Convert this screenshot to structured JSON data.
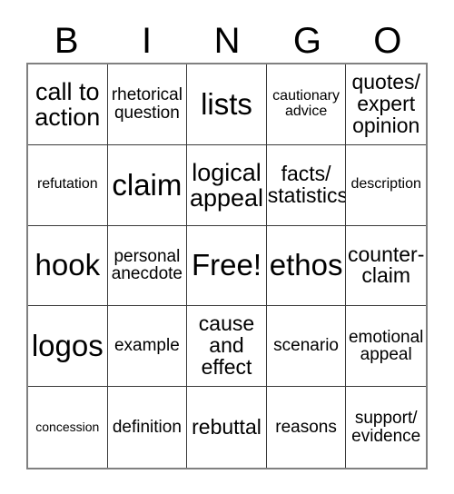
{
  "card": {
    "header": {
      "letters": [
        "B",
        "I",
        "N",
        "G",
        "O"
      ]
    },
    "grid": {
      "columns": 5,
      "rows": 5,
      "cells": [
        {
          "text": "call to\naction",
          "size": "xl"
        },
        {
          "text": "rhetorical\nquestion",
          "size": "m"
        },
        {
          "text": "lists",
          "size": "xxl"
        },
        {
          "text": "cautionary\nadvice",
          "size": "s"
        },
        {
          "text": "quotes/\nexpert\nopinion",
          "size": "l"
        },
        {
          "text": "refutation",
          "size": "s"
        },
        {
          "text": "claim",
          "size": "xxl"
        },
        {
          "text": "logical\nappeal",
          "size": "xl"
        },
        {
          "text": "facts/\nstatistics",
          "size": "l"
        },
        {
          "text": "description",
          "size": "s"
        },
        {
          "text": "hook",
          "size": "xxl"
        },
        {
          "text": "personal\nanecdote",
          "size": "m"
        },
        {
          "text": "Free!",
          "size": "xxl"
        },
        {
          "text": "ethos",
          "size": "xxl"
        },
        {
          "text": "counter-\nclaim",
          "size": "l"
        },
        {
          "text": "logos",
          "size": "xxl"
        },
        {
          "text": "example",
          "size": "m"
        },
        {
          "text": "cause\nand\neffect",
          "size": "l"
        },
        {
          "text": "scenario",
          "size": "m"
        },
        {
          "text": "emotional\nappeal",
          "size": "m"
        },
        {
          "text": "concession",
          "size": "xs"
        },
        {
          "text": "definition",
          "size": "m"
        },
        {
          "text": "rebuttal",
          "size": "l"
        },
        {
          "text": "reasons",
          "size": "m"
        },
        {
          "text": "support/\nevidence",
          "size": "m"
        }
      ]
    },
    "colors": {
      "text": "#000000",
      "cell_background": "#ffffff",
      "inner_border": "#3a3a3a",
      "outer_border": "#808080"
    }
  }
}
